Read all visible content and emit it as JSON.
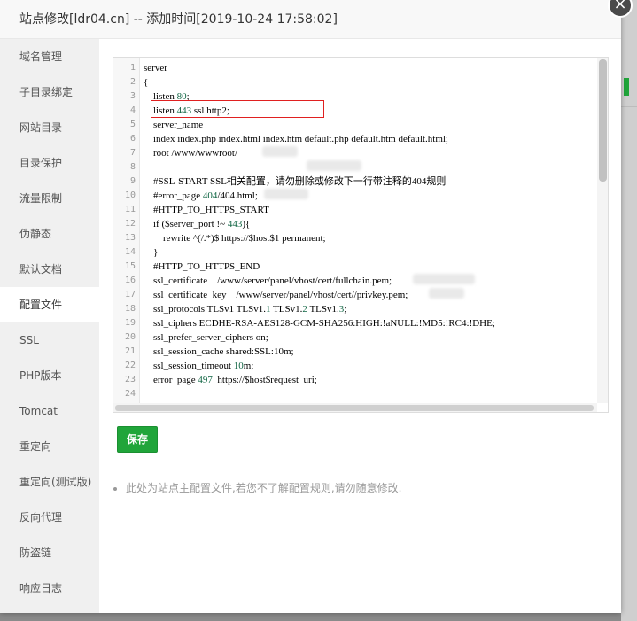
{
  "dialog": {
    "title": "站点修改[ldr04.cn] -- 添加时间[2019-10-24 17:58:02]",
    "close_icon": "×"
  },
  "sidebar": {
    "items": [
      {
        "label": "域名管理"
      },
      {
        "label": "子目录绑定"
      },
      {
        "label": "网站目录"
      },
      {
        "label": "目录保护"
      },
      {
        "label": "流量限制"
      },
      {
        "label": "伪静态"
      },
      {
        "label": "默认文档"
      },
      {
        "label": "配置文件",
        "active": true
      },
      {
        "label": "SSL"
      },
      {
        "label": "PHP版本"
      },
      {
        "label": "Tomcat"
      },
      {
        "label": "重定向"
      },
      {
        "label": "重定向(测试版)"
      },
      {
        "label": "反向代理"
      },
      {
        "label": "防盗链"
      },
      {
        "label": "响应日志"
      }
    ]
  },
  "editor": {
    "line_numbers": [
      "1",
      "2",
      "3",
      "4",
      "5",
      "6",
      "7",
      "8",
      "9",
      "10",
      "11",
      "12",
      "13",
      "14",
      "15",
      "16",
      "17",
      "18",
      "19",
      "20",
      "21",
      "22",
      "23",
      "24"
    ],
    "lines": [
      {
        "n": "1",
        "parts": [
          "server"
        ]
      },
      {
        "n": "2",
        "parts": [
          "{"
        ]
      },
      {
        "n": "3",
        "parts": [
          "    listen ",
          "80",
          ";"
        ]
      },
      {
        "n": "4",
        "parts": [
          "    listen ",
          "443",
          " ssl http2;"
        ]
      },
      {
        "n": "5",
        "parts": [
          "    server_name "
        ]
      },
      {
        "n": "6",
        "parts": [
          "    index index.php index.html index.htm default.php default.htm default.html;"
        ]
      },
      {
        "n": "7",
        "parts": [
          "    root /www/wwwroot/"
        ]
      },
      {
        "n": "8",
        "parts": [
          ""
        ]
      },
      {
        "n": "9",
        "parts": [
          "    #SSL-START SSL相关配置，请勿删除或修改下一行带注释的404规则"
        ]
      },
      {
        "n": "10",
        "parts": [
          "    #error_page ",
          "404",
          "/404.html;"
        ]
      },
      {
        "n": "11",
        "parts": [
          "    #HTTP_TO_HTTPS_START"
        ]
      },
      {
        "n": "12",
        "parts": [
          "    if ($server_port !~ ",
          "443",
          "){"
        ]
      },
      {
        "n": "13",
        "parts": [
          "        rewrite ^(/.*)$ https://$host$1 permanent;"
        ]
      },
      {
        "n": "14",
        "parts": [
          "    }"
        ]
      },
      {
        "n": "15",
        "parts": [
          "    #HTTP_TO_HTTPS_END"
        ]
      },
      {
        "n": "16",
        "parts": [
          "    ssl_certificate    /www/server/panel/vhost/cert",
          "",
          "/fullchain.pem;"
        ]
      },
      {
        "n": "17",
        "parts": [
          "    ssl_certificate_key    /www/server/panel/vhost/cert/",
          "",
          "/privkey.pem;"
        ]
      },
      {
        "n": "18",
        "parts": [
          "    ssl_protocols TLSv1 TLSv1.",
          "1",
          " TLSv1.",
          "2",
          " TLSv1.",
          "3",
          ";"
        ]
      },
      {
        "n": "19",
        "parts": [
          "    ssl_ciphers ECDHE-RSA-AES128-GCM-SHA256:HIGH:!aNULL:!MD5:!RC4:!DHE;"
        ]
      },
      {
        "n": "20",
        "parts": [
          "    ssl_prefer_server_ciphers on;"
        ]
      },
      {
        "n": "21",
        "parts": [
          "    ssl_session_cache shared:SSL:10m;"
        ]
      },
      {
        "n": "22",
        "parts": [
          "    ssl_session_timeout ",
          "10",
          "m;"
        ]
      },
      {
        "n": "23",
        "parts": [
          "    error_page ",
          "497",
          "  https://$host$request_uri;"
        ]
      },
      {
        "n": "24",
        "parts": [
          ""
        ]
      }
    ]
  },
  "save_button": {
    "label": "保存"
  },
  "hint": {
    "text": "此处为站点主配置文件,若您不了解配置规则,请勿随意修改."
  },
  "colors": {
    "accent": "#20a53a",
    "highlight_border": "#e02020",
    "number": "#116644"
  }
}
